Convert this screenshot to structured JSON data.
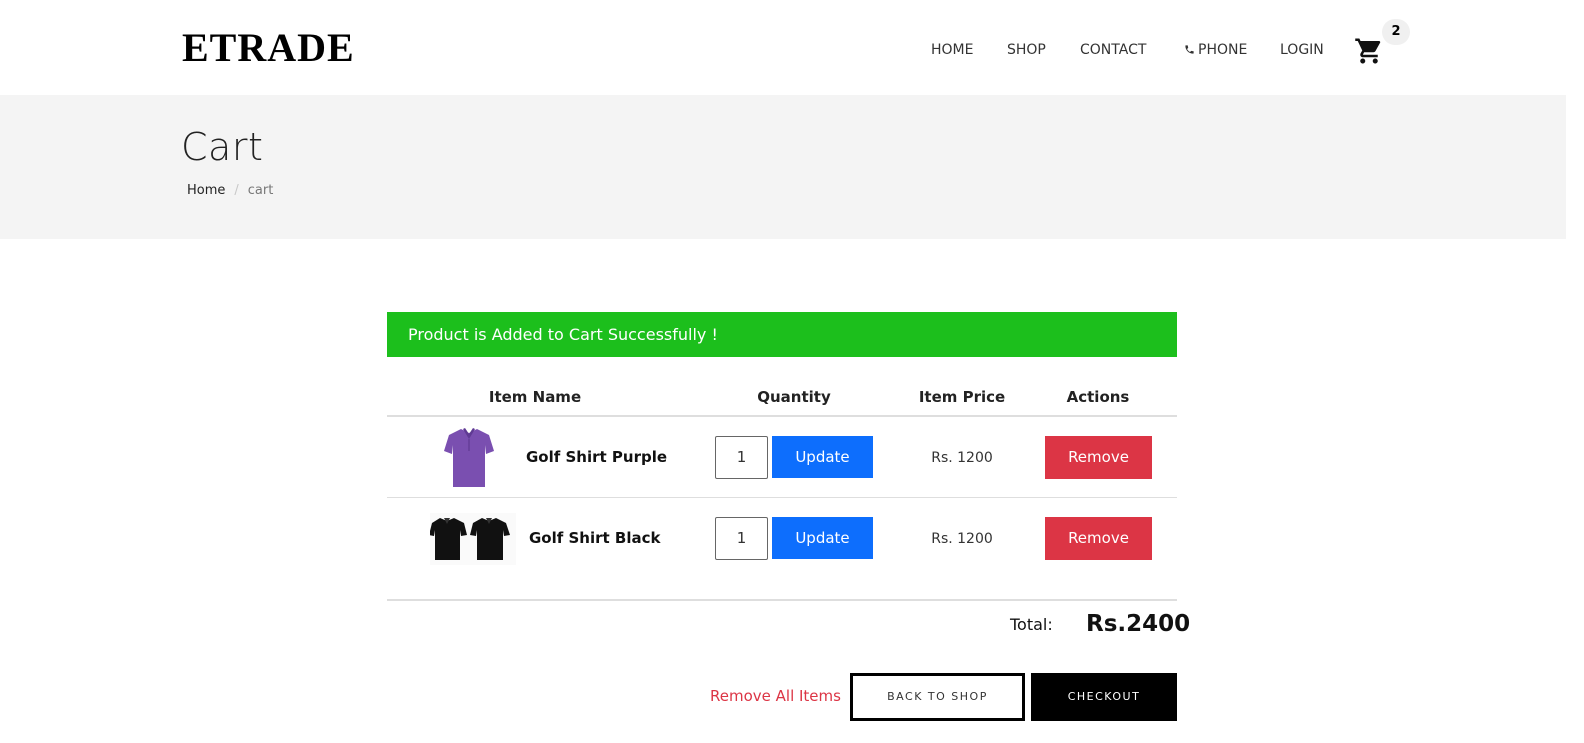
{
  "header": {
    "logo": "ETRADE",
    "nav": {
      "home": "HOME",
      "shop": "SHOP",
      "contact": "CONTACT",
      "phone": "PHONE",
      "login": "LOGIN"
    },
    "cart_count": "2",
    "cart_icon": "shopping-cart-icon"
  },
  "banner": {
    "title": "Cart",
    "breadcrumb": {
      "home": "Home",
      "separator": "/",
      "current": "cart"
    }
  },
  "alert": {
    "message": "Product is Added to Cart Successfully !",
    "color": "#1cbf1c"
  },
  "table": {
    "headers": [
      "Item Name",
      "Quantity",
      "Item Price",
      "Actions"
    ],
    "rows": [
      {
        "name": "Golf Shirt Purple",
        "quantity": "1",
        "price": "Rs. 1200",
        "update_label": "Update",
        "remove_label": "Remove",
        "image_color": "#7a4fb0"
      },
      {
        "name": "Golf Shirt Black",
        "quantity": "1",
        "price": "Rs. 1200",
        "update_label": "Update",
        "remove_label": "Remove",
        "image_color": "#111111"
      }
    ]
  },
  "totals": {
    "label": "Total:",
    "value": "Rs.2400"
  },
  "actions": {
    "remove_all": "Remove All Items",
    "back_to_shop": "BACK TO SHOP",
    "checkout": "CHECKOUT"
  },
  "colors": {
    "update": "#0d6efd",
    "remove": "#dc3545",
    "checkout": "#000000"
  }
}
